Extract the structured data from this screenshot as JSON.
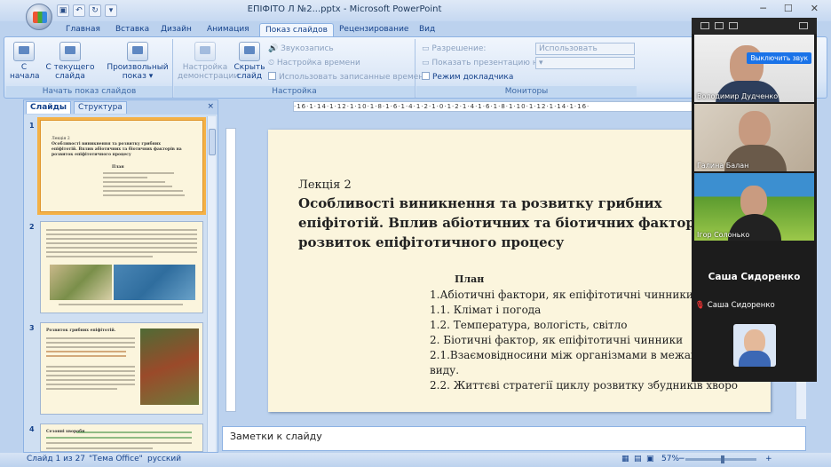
{
  "window": {
    "title": "ЕПІФІТО Л №2...pptx - Microsoft PowerPoint",
    "minimize": "─",
    "maximize": "☐",
    "close": "✕"
  },
  "tabs": [
    "Главная",
    "Вставка",
    "Дизайн",
    "Анимация",
    "Показ слайдов",
    "Рецензирование",
    "Вид"
  ],
  "active_tab": "Показ слайдов",
  "ribbon": {
    "start_group": {
      "label": "Начать показ слайдов",
      "from_start": "С\nначала",
      "from_current": "С текущего\nслайда",
      "custom": "Произвольный\nпоказ ▾"
    },
    "setup_group": {
      "label": "Настройка",
      "setup_demo": "Настройка\nдемонстрации",
      "hide_slide": "Скрыть\nслайд",
      "record": "Звукозапись",
      "rehearse": "Настройка времени",
      "use_timings": "Использовать записанные времена"
    },
    "monitors_group": {
      "label": "Мониторы",
      "resolution_label": "Разрешение:",
      "resolution_value": "Использовать текуще...",
      "show_on_label": "Показать презентацию на:",
      "presenter_view": "Режим докладчика"
    }
  },
  "left_pane": {
    "tab_slides": "Слайды",
    "tab_outline": "Структура",
    "close": "×"
  },
  "thumbnails": [
    {
      "num": "1",
      "lines": [
        "Лекція 2",
        "Особливості виникнення та розвитку грибних",
        "епіфітотій.  Вплив абіотичних та біотичних факторів на",
        "розвиток епіфітотичного процесу",
        "План"
      ]
    },
    {
      "num": "2"
    },
    {
      "num": "3",
      "title": "Розвиток грибних епіфітотій."
    },
    {
      "num": "4",
      "title": "Сезонні хвороби"
    }
  ],
  "slide": {
    "lecture": "Лекція 2",
    "title_lines": [
      "Особливості виникнення та розвитку грибних",
      "епіфітотій.  Вплив абіотичних та біотичних факторі",
      "розвиток епіфітотичного процесу"
    ],
    "plan_heading": "План",
    "plan_items": [
      "1.Абіотичні фактори, як епіфітотичні чинники",
      "1.1. Клімат і погода",
      "1.2. Температура, вологість, світло",
      "2. Біотичні фактор, як епіфітотичні чинники",
      "2.1.Взаємовідносини між організмами в межах од",
      "виду.",
      "2.2. Життєві стратегії циклу розвитку збудників  хворо"
    ]
  },
  "notes_placeholder": "Заметки к слайду",
  "ruler_text": "·16·1·14·1·12·1·10·1·8·1·6·1·4·1·2·1·0·1·2·1·4·1·6·1·8·1·10·1·12·1·14·1·16·",
  "status": {
    "slide": "Слайд 1 из 27",
    "theme": "\"Тема Office\"",
    "lang": "русский",
    "zoom": "57%",
    "zoom_minus": "−",
    "zoom_plus": "+"
  },
  "zoom_call": {
    "unmute_btn": "Выключить звук",
    "more": "···",
    "participants": [
      "Володимир Дудченко",
      "Галина Балан",
      "Ігор Солонько"
    ],
    "active_speaker_big": "Саша Сидоренко",
    "active_speaker_small": "Саша Сидоренко"
  },
  "colors": {
    "ribbon_blue": "#bcd2ee",
    "accent_orange": "#f4b146",
    "slide_bg": "#fbf5dd",
    "zoom_dark": "#1c1c1c",
    "unmute_blue": "#1a73e8"
  }
}
